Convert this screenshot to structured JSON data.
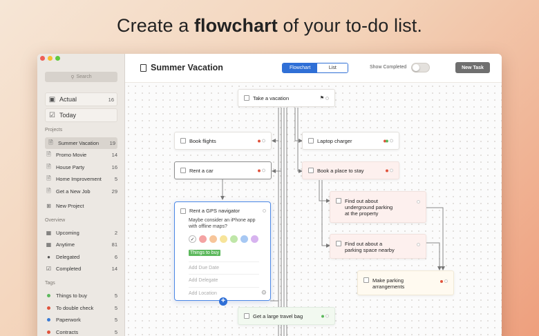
{
  "headline": {
    "pre": "Create a ",
    "bold": "flowchart",
    "post": " of your to-do list."
  },
  "sidebar": {
    "search_placeholder": "Search",
    "top": [
      {
        "label": "Actual",
        "count": "16",
        "icon": "inbox-icon"
      },
      {
        "label": "Today",
        "count": "",
        "icon": "calendar-check-icon"
      }
    ],
    "projects_heading": "Projects",
    "projects": [
      {
        "label": "Summer Vacation",
        "count": "19"
      },
      {
        "label": "Promo Movie",
        "count": "14"
      },
      {
        "label": "House Party",
        "count": "16"
      },
      {
        "label": "Home Improvement",
        "count": "5"
      },
      {
        "label": "Get a New Job",
        "count": "29"
      }
    ],
    "new_project": "New Project",
    "overview_heading": "Overview",
    "overview": [
      {
        "label": "Upcoming",
        "count": "2",
        "icon": "calendar-icon"
      },
      {
        "label": "Anytime",
        "count": "81",
        "icon": "grid-calendar-icon"
      },
      {
        "label": "Delegated",
        "count": "6",
        "icon": "person-icon"
      },
      {
        "label": "Completed",
        "count": "14",
        "icon": "checkbox-checked-icon"
      }
    ],
    "tags_heading": "Tags",
    "tags": [
      {
        "label": "Things to buy",
        "count": "5",
        "color": "#5cb85c"
      },
      {
        "label": "To double check",
        "count": "5",
        "color": "#e0533c"
      },
      {
        "label": "Paperwork",
        "count": "5",
        "color": "#3a7bd5"
      },
      {
        "label": "Contracts",
        "count": "5",
        "color": "#e0533c"
      }
    ]
  },
  "toolbar": {
    "title": "Summer Vacation",
    "view_flowchart": "Flowchart",
    "view_list": "List",
    "show_completed": "Show Completed",
    "new_task": "New Task"
  },
  "colors": {
    "accent": "#2f6fd6",
    "tag_green": "#5cb85c",
    "tag_red": "#e0533c"
  },
  "tasks": {
    "take_vacation": "Take a vacation",
    "book_flights": "Book flights",
    "laptop_charger": "Laptop charger",
    "rent_car": "Rent a car",
    "book_place": "Book a place to stay",
    "underground_1": "Find out about",
    "underground_2": "underground parking",
    "underground_3": "at the property",
    "parking_1": "Find out about a",
    "parking_2": "parking space nearby",
    "make_parking_1": "Make parking",
    "make_parking_2": "arrangements",
    "travel_bag": "Get a large travel bag"
  },
  "editor": {
    "title": "Rent a GPS navigator",
    "note": "Maybe consider an iPhone app with offline maps?",
    "swatch_colors": [
      "#ffffff",
      "#f4a3a3",
      "#f7c59a",
      "#f7e49a",
      "#bfe6a8",
      "#a7c8f3",
      "#d7b3ef"
    ],
    "tag": "Things to buy",
    "due_placeholder": "Add Due Date",
    "delegate_placeholder": "Add Delegate",
    "location_placeholder": "Add Location"
  }
}
